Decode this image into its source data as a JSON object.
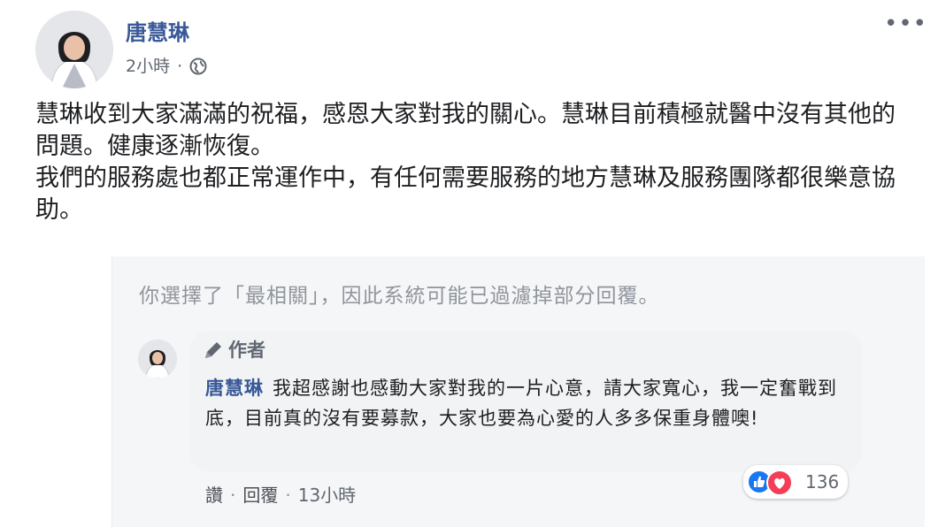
{
  "post": {
    "author": "唐慧琳",
    "time": "2小時",
    "separator": "·",
    "more": "•••",
    "body_lines": [
      "慧琳收到大家滿滿的祝福，感恩大家對我的關心。慧琳目前積極就醫中沒有其他的問題。健康逐漸恢復。",
      "我們的服務處也都正常運作中，有任何需要服務的地方慧琳及服務團隊都很樂意協助。"
    ]
  },
  "comments": {
    "filter_note": "你選擇了「最相關」，因此系統可能已過濾掉部分回覆。",
    "author_badge": "作者",
    "comment_author": "唐慧琳",
    "comment_text": "我超感謝也感動大家對我的一片心意，請大家寬心，我一定奮戰到底，目前真的沒有要募款，大家也要為心愛的人多多保重身體噢!",
    "reaction_count": "136",
    "actions": {
      "like": "讚",
      "reply": "回覆",
      "time": "13小時",
      "sep": "·"
    }
  },
  "colors": {
    "link_blue": "#385898",
    "like_blue": "#1877f2",
    "love_red": "#f33e58"
  },
  "icons": [
    "globe-icon",
    "more-icon",
    "pencil-icon",
    "like-icon",
    "love-icon"
  ]
}
